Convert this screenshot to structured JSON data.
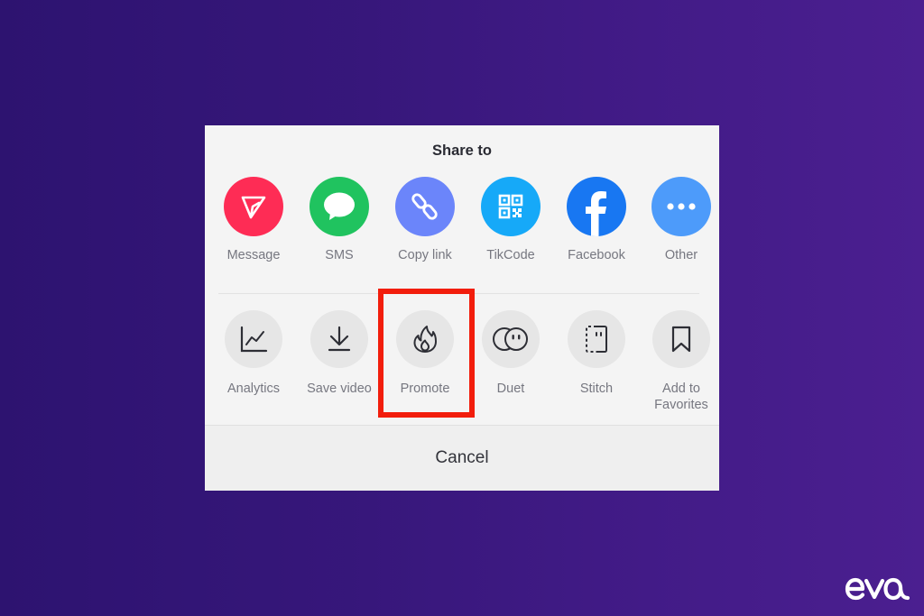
{
  "share_sheet": {
    "title": "Share to",
    "share_targets": [
      {
        "label": "Message",
        "icon": "send-icon",
        "color": "#fe2c55"
      },
      {
        "label": "SMS",
        "icon": "chat-bubble-icon",
        "color": "#20c35f"
      },
      {
        "label": "Copy link",
        "icon": "link-icon",
        "color": "#6b85fa"
      },
      {
        "label": "TikCode",
        "icon": "qr-code-icon",
        "color": "#16a9f8"
      },
      {
        "label": "Facebook",
        "icon": "facebook-icon",
        "color": "#1877f2"
      },
      {
        "label": "Other",
        "icon": "more-dots-icon",
        "color": "#4d9bfa"
      }
    ],
    "actions": [
      {
        "label": "Analytics",
        "icon": "analytics-chart-icon"
      },
      {
        "label": "Save video",
        "icon": "download-icon"
      },
      {
        "label": "Promote",
        "icon": "flame-icon",
        "highlighted": true
      },
      {
        "label": "Duet",
        "icon": "duet-icon"
      },
      {
        "label": "Stitch",
        "icon": "stitch-icon"
      },
      {
        "label": "Add to Favorites",
        "icon": "bookmark-icon"
      }
    ],
    "cancel_label": "Cancel"
  },
  "highlight": {
    "target": "Promote",
    "color": "#f21d0c"
  },
  "branding": {
    "logo_text": "eva"
  }
}
